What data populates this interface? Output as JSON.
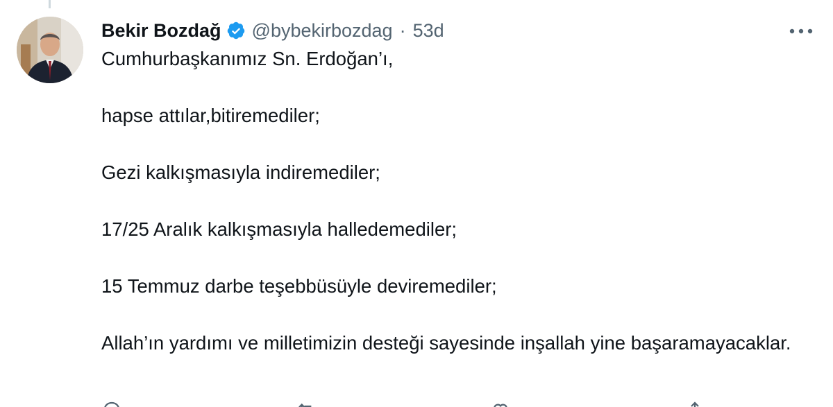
{
  "tweet": {
    "author_name": "Bekir Bozdağ",
    "handle": "@bybekirbozdag",
    "separator": "·",
    "time": "53d",
    "paragraphs": [
      "Cumhurbaşkanımız Sn. Erdoğan’ı,",
      "hapse attılar,bitiremediler;",
      "Gezi kalkışmasıyla indiremediler;",
      "17/25 Aralık kalkışmasıyla halledemediler;",
      "15 Temmuz darbe teşebbüsüyle deviremediler;",
      "Allah’ın yardımı ve milletimizin desteği sayesinde inşallah yine başaramayacaklar."
    ]
  },
  "icons": {
    "verified": "verified-badge-icon",
    "more": "more-options-icon",
    "reply": "reply-icon",
    "retweet": "retweet-icon",
    "like": "like-icon",
    "share": "share-icon"
  },
  "colors": {
    "text": "#0f1419",
    "secondary": "#536471",
    "verified": "#1d9bf0"
  }
}
